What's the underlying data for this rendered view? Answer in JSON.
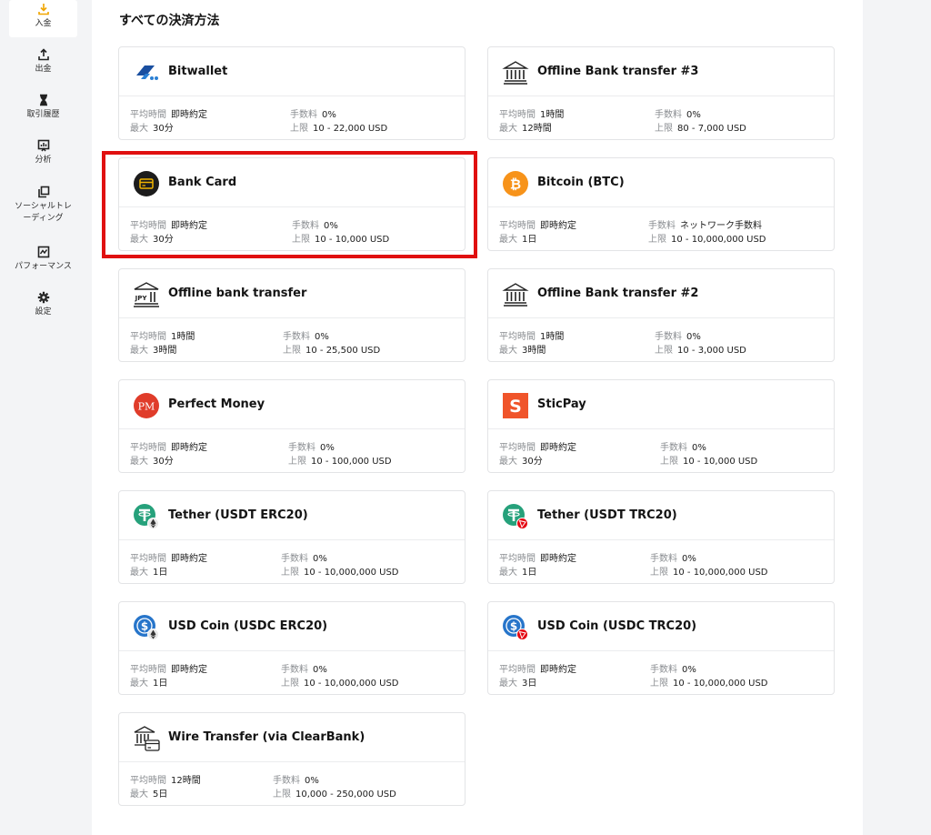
{
  "sidebar": {
    "items": [
      {
        "label": "入金",
        "icon": "download-icon"
      },
      {
        "label": "出金",
        "icon": "upload-icon"
      },
      {
        "label": "取引履歴",
        "icon": "hourglass-icon"
      },
      {
        "label": "分析",
        "icon": "chart-icon"
      },
      {
        "label": "ソーシャルトレーディング",
        "icon": "copy-icon"
      },
      {
        "label": "パフォーマンス",
        "icon": "performance-icon"
      },
      {
        "label": "設定",
        "icon": "gear-icon"
      }
    ]
  },
  "main": {
    "title": "すべての決済方法",
    "labels": {
      "time": "平均時間",
      "max": "最大",
      "fee": "手数料",
      "limit": "上限"
    },
    "methods": [
      {
        "name": "Bitwallet",
        "icon": "bitwallet-icon",
        "time": "即時約定",
        "max": "30分",
        "fee": "0%",
        "limit": "10 - 22,000 USD"
      },
      {
        "name": "Offline Bank transfer #3",
        "icon": "bank-icon",
        "time": "1時間",
        "max": "12時間",
        "fee": "0%",
        "limit": "80 - 7,000 USD"
      },
      {
        "name": "Bank Card",
        "icon": "bank-card-icon",
        "time": "即時約定",
        "max": "30分",
        "fee": "0%",
        "limit": "10 - 10,000 USD"
      },
      {
        "name": "Bitcoin (BTC)",
        "icon": "bitcoin-icon",
        "time": "即時約定",
        "max": "1日",
        "fee": "ネットワーク手数料",
        "limit": "10 - 10,000,000 USD"
      },
      {
        "name": "Offline bank transfer",
        "icon": "jpy-bank-icon",
        "icon_text": "JPY",
        "time": "1時間",
        "max": "3時間",
        "fee": "0%",
        "limit": "10 - 25,500 USD"
      },
      {
        "name": "Offline Bank transfer #2",
        "icon": "bank-icon",
        "time": "1時間",
        "max": "3時間",
        "fee": "0%",
        "limit": "10 - 3,000 USD"
      },
      {
        "name": "Perfect Money",
        "icon": "perfect-money-icon",
        "icon_text": "PM",
        "time": "即時約定",
        "max": "30分",
        "fee": "0%",
        "limit": "10 - 100,000 USD"
      },
      {
        "name": "SticPay",
        "icon": "sticpay-icon",
        "icon_text": "S",
        "time": "即時約定",
        "max": "30分",
        "fee": "0%",
        "limit": "10 - 10,000 USD"
      },
      {
        "name": "Tether (USDT ERC20)",
        "icon": "tether-erc20-icon",
        "time": "即時約定",
        "max": "1日",
        "fee": "0%",
        "limit": "10 - 10,000,000 USD"
      },
      {
        "name": "Tether (USDT TRC20)",
        "icon": "tether-trc20-icon",
        "time": "即時約定",
        "max": "1日",
        "fee": "0%",
        "limit": "10 - 10,000,000 USD"
      },
      {
        "name": "USD Coin (USDC ERC20)",
        "icon": "usdc-erc20-icon",
        "time": "即時約定",
        "max": "1日",
        "fee": "0%",
        "limit": "10 - 10,000,000 USD"
      },
      {
        "name": "USD Coin (USDC TRC20)",
        "icon": "usdc-trc20-icon",
        "time": "即時約定",
        "max": "3日",
        "fee": "0%",
        "limit": "10 - 10,000,000 USD"
      },
      {
        "name": "Wire Transfer (via ClearBank)",
        "icon": "wire-transfer-icon",
        "time": "12時間",
        "max": "5日",
        "fee": "0%",
        "limit": "10,000 - 250,000 USD"
      }
    ]
  },
  "colors": {
    "highlight": "#e01010",
    "bitcoin": "#f7931a",
    "tether": "#26a17b",
    "usdc": "#2775ca",
    "perfect_money": "#e03c2a",
    "sticpay": "#f0542a",
    "bitwallet": "#1a4fa0"
  }
}
